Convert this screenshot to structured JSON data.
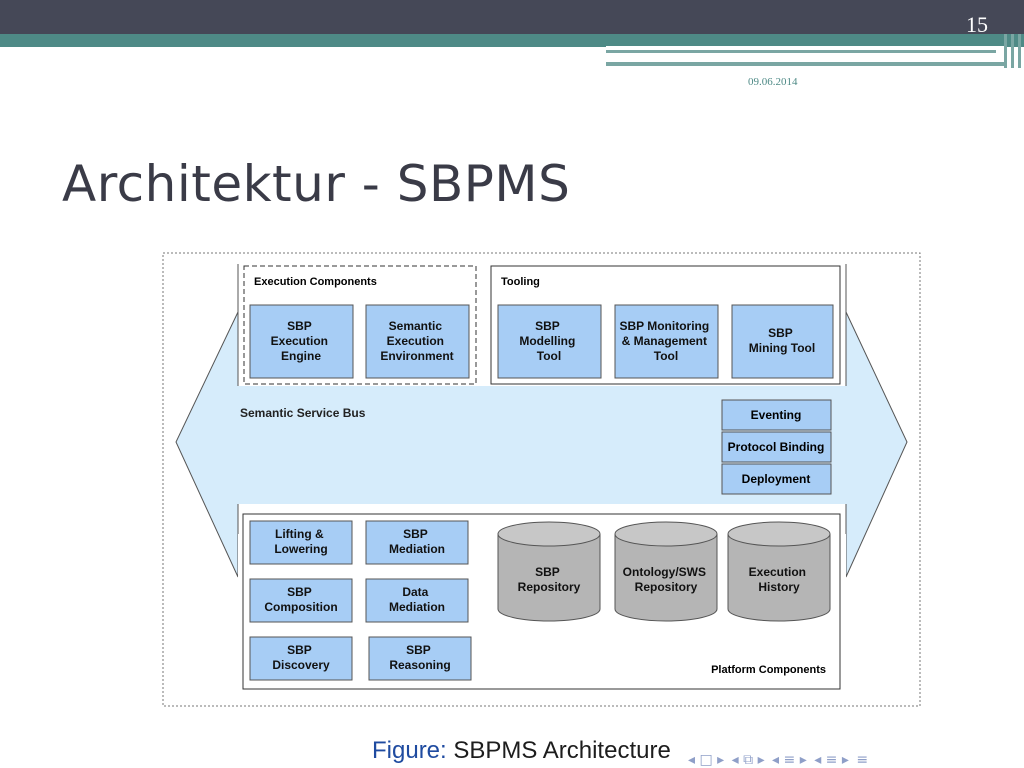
{
  "slide": {
    "number": "15",
    "date": "09.06.2014",
    "title": "Architektur - SBPMS"
  },
  "diagram": {
    "execution_group": {
      "label": "Execution Components",
      "boxes": [
        [
          "SBP",
          "Execution",
          "Engine"
        ],
        [
          "Semantic",
          "Execution",
          "Environment"
        ]
      ]
    },
    "tooling_group": {
      "label": "Tooling",
      "boxes": [
        [
          "SBP",
          "Modelling",
          "Tool"
        ],
        [
          "SBP Monitoring",
          "& Management",
          "Tool"
        ],
        [
          "SBP",
          "Mining Tool"
        ]
      ]
    },
    "bus": {
      "label": "Semantic Service Bus",
      "services": [
        "Eventing",
        "Protocol Binding",
        "Deployment"
      ]
    },
    "platform_group": {
      "label": "Platform Components",
      "boxes": [
        [
          "Lifting &",
          "Lowering"
        ],
        [
          "SBP",
          "Mediation"
        ],
        [
          "SBP",
          "Composition"
        ],
        [
          "Data",
          "Mediation"
        ],
        [
          "SBP",
          "Discovery"
        ],
        [
          "SBP",
          "Reasoning"
        ]
      ],
      "repositories": [
        [
          "SBP",
          "Repository"
        ],
        [
          "Ontology/SWS",
          "Repository"
        ],
        [
          "Execution",
          "History"
        ]
      ]
    },
    "colors": {
      "box_fill": "#a7cdf5",
      "bus_fill": "#d6ecfb",
      "cylinder_fill": "#b5b5b5"
    }
  },
  "caption": {
    "prefix": "Figure:",
    "text": "SBPMS Architecture"
  },
  "nav_icons": [
    "nav-prev-icon",
    "nav-slide-icon",
    "nav-next-icon",
    "nav-frame-icon",
    "nav-section-icon",
    "nav-subsection-icon",
    "nav-menu-icon"
  ]
}
